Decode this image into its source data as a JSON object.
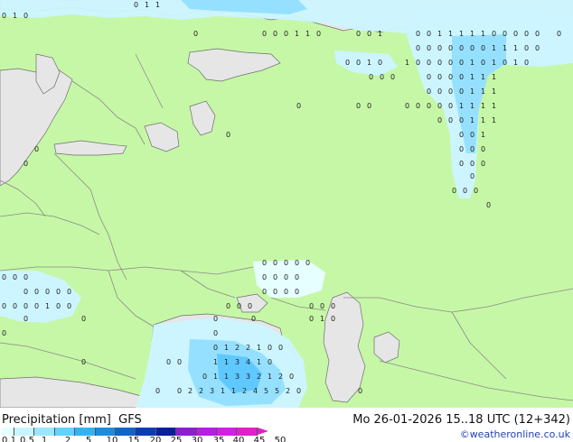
{
  "legend": {
    "title": "Precipitation [mm]  GFS",
    "ticks": [
      "0.1",
      "0.5",
      "1",
      "2",
      "5",
      "10",
      "15",
      "20",
      "25",
      "30",
      "35",
      "40",
      "45",
      "50"
    ],
    "colors": [
      "#e6ffff",
      "#c8f5ff",
      "#9ae6ff",
      "#64d2ff",
      "#32b4f0",
      "#1e8cdc",
      "#1464c8",
      "#0a3cb4",
      "#0a1e9e",
      "#8c1ed2",
      "#b41ee6",
      "#d21ee6",
      "#e61ec8"
    ]
  },
  "valid_time": "Mo 26-01-2026 15..18 UTC (12+342)",
  "credit": "©weatheronline.co.uk",
  "colors": {
    "land": "#c6f7a6",
    "sea": "#e6e6e6",
    "precip_light": "#ccf5ff",
    "precip_medium": "#96e0ff",
    "precip_heavy": "#5fc8ff",
    "borders": "#888888",
    "coast": "#6e6e6e"
  },
  "map_labels": [
    {
      "text": "0",
      "lon": 8,
      "lat": 4
    },
    {
      "text": "1",
      "lon": 20,
      "lat": 4
    },
    {
      "text": "1",
      "lon": 30,
      "lat": 4
    }
  ]
}
